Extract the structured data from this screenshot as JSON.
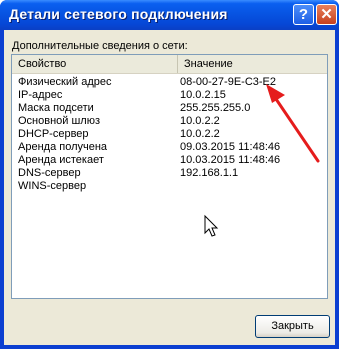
{
  "window": {
    "title": "Детали сетевого подключения",
    "help_button": "?",
    "close_button": "✕"
  },
  "dialog": {
    "description": "Дополнительные сведения о сети:",
    "columns": [
      "Свойство",
      "Значение"
    ],
    "rows": [
      {
        "property": "Физический адрес",
        "value": "08-00-27-9E-C3-E2"
      },
      {
        "property": "IP-адрес",
        "value": "10.0.2.15"
      },
      {
        "property": "Маска подсети",
        "value": "255.255.255.0"
      },
      {
        "property": "Основной шлюз",
        "value": "10.0.2.2"
      },
      {
        "property": "DHCP-сервер",
        "value": "10.0.2.2"
      },
      {
        "property": "Аренда получена",
        "value": "09.03.2015 11:48:46"
      },
      {
        "property": "Аренда истекает",
        "value": "10.03.2015 11:48:46"
      },
      {
        "property": "DNS-сервер",
        "value": "192.168.1.1"
      },
      {
        "property": "WINS-сервер",
        "value": ""
      }
    ],
    "close_label": "Закрыть"
  },
  "colors": {
    "titlebar": "#0754e2",
    "dialog_face": "#ece9d8",
    "annotation_arrow": "#e51c1c"
  },
  "icons": {
    "help": "question-mark-icon",
    "close": "close-x-icon",
    "cursor": "mouse-pointer-icon",
    "annotation": "red-arrow-annotation"
  }
}
